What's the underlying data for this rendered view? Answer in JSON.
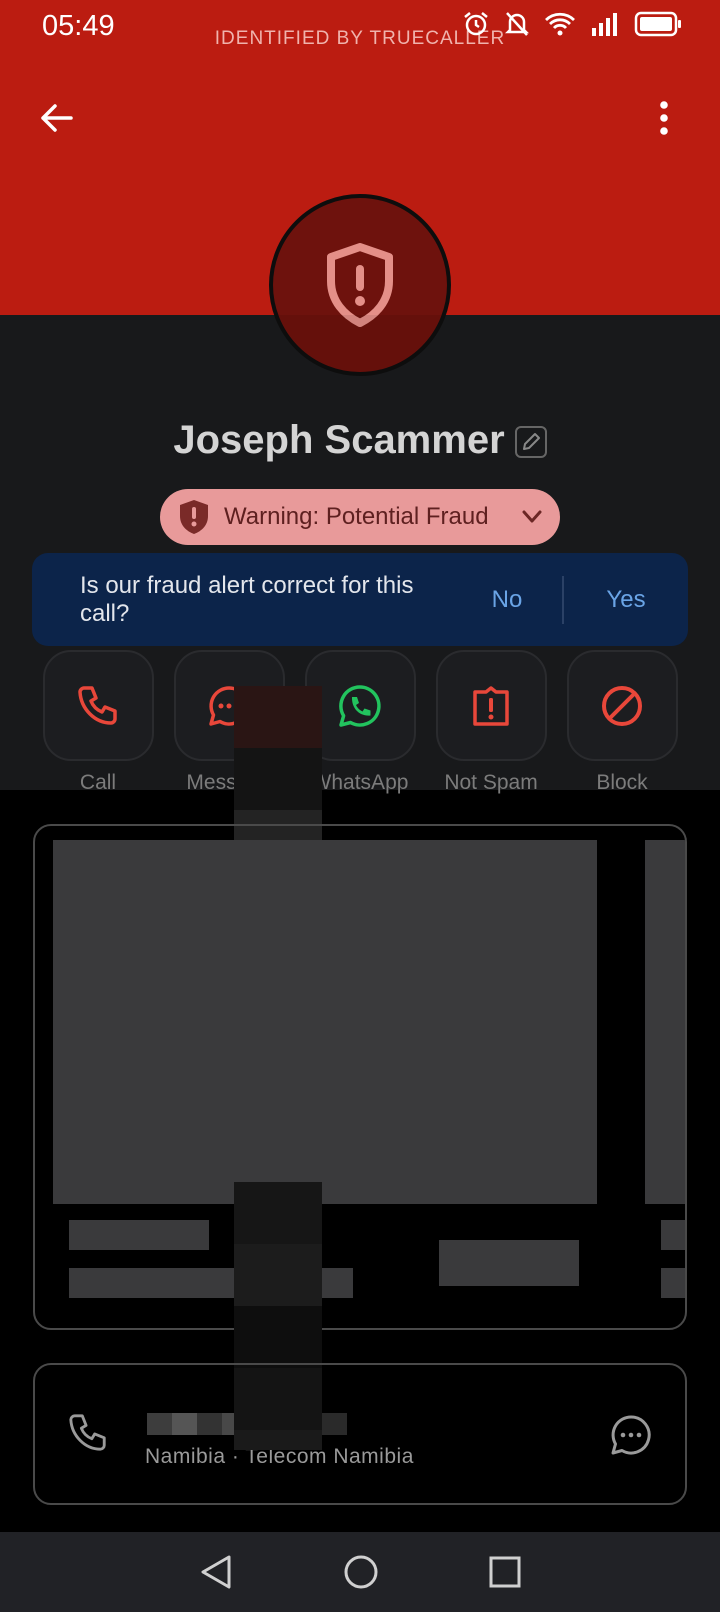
{
  "status_bar": {
    "time": "05:49",
    "overlay_text": "IDENTIFIED BY TRUECALLER",
    "icons": [
      "alarm-icon",
      "mute-icon",
      "wifi-icon",
      "signal-icon",
      "battery-icon"
    ]
  },
  "header": {
    "back_icon": "arrow-left-icon",
    "menu_icon": "more-vertical-icon"
  },
  "profile": {
    "avatar_icon": "shield-alert-icon",
    "name": "Joseph Scammer",
    "edit_icon": "pencil-icon",
    "warning": "Warning: Potential Fraud"
  },
  "feedback": {
    "question": "Is our fraud alert correct for this call?",
    "no": "No",
    "yes": "Yes"
  },
  "actions": [
    {
      "label": "Call",
      "icon": "phone-icon",
      "color": "#e8473a"
    },
    {
      "label": "Message",
      "icon": "message-icon",
      "color": "#e8473a"
    },
    {
      "label": "WhatsApp",
      "icon": "whatsapp-icon",
      "color": "#22c35e"
    },
    {
      "label": "Not Spam",
      "icon": "not-spam-icon",
      "color": "#e8473a"
    },
    {
      "label": "Block",
      "icon": "block-icon",
      "color": "#e8473a"
    }
  ],
  "contact": {
    "location": "Namibia · Telecom Namibia"
  },
  "colors": {
    "header_red": "#bb1c11",
    "dark_bg": "#18191b",
    "feedback_bg": "#0c244a",
    "link_blue": "#6aa4e6",
    "warning_pill": "#e89a9a"
  }
}
